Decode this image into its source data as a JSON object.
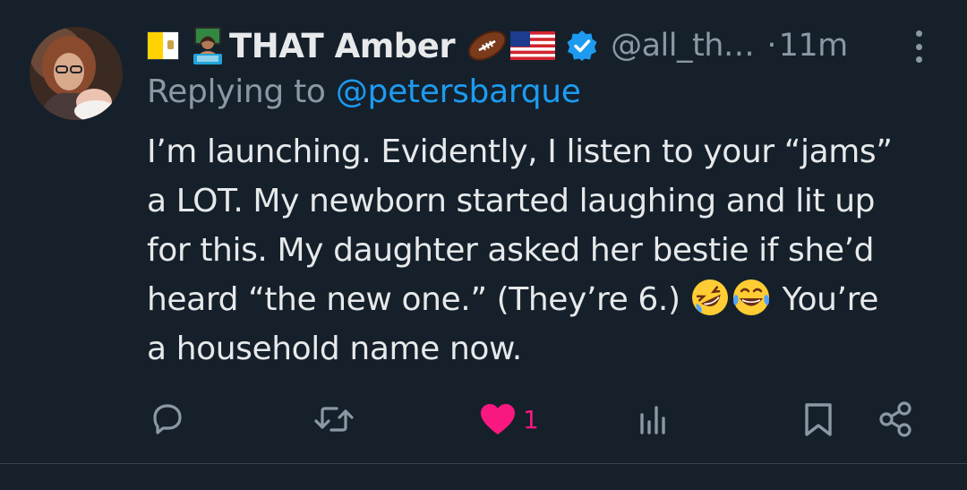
{
  "tweet": {
    "author": {
      "name_prefix_icons": [
        "vatican-flag-icon",
        "technologist-emoji-icon"
      ],
      "display_name": "THAT Amber",
      "name_suffix_icons": [
        "football-emoji-icon",
        "us-flag-emoji-icon",
        "verified-badge-icon"
      ],
      "handle": "@all_th…",
      "separator": "·",
      "time": "11m"
    },
    "replying": {
      "prefix": "Replying to ",
      "mention": "@petersbarque"
    },
    "body": {
      "line1": "I’m launching. Evidently, I listen to your “jams”",
      "line2": "a LOT. My newborn started laughing and lit up",
      "line3": "for this. My daughter asked her bestie if she’d",
      "line4_start": "heard “the new one.” (They’re 6.) ",
      "line4_emojis": [
        "rolling-on-floor-laughing-emoji-icon",
        "tears-of-joy-emoji-icon"
      ],
      "line4_end": " You’re",
      "line5": "a household name now."
    },
    "actions": {
      "reply_icon": "reply-icon",
      "retweet_icon": "retweet-icon",
      "like_icon": "heart-filled-icon",
      "like_count": "1",
      "views_icon": "analytics-icon",
      "bookmark_icon": "bookmark-icon",
      "share_icon": "share-icon"
    },
    "colors": {
      "background": "#15202b",
      "text": "#e7e9ea",
      "muted": "#8b98a5",
      "link": "#1d9bf0",
      "like": "#f91880"
    }
  }
}
